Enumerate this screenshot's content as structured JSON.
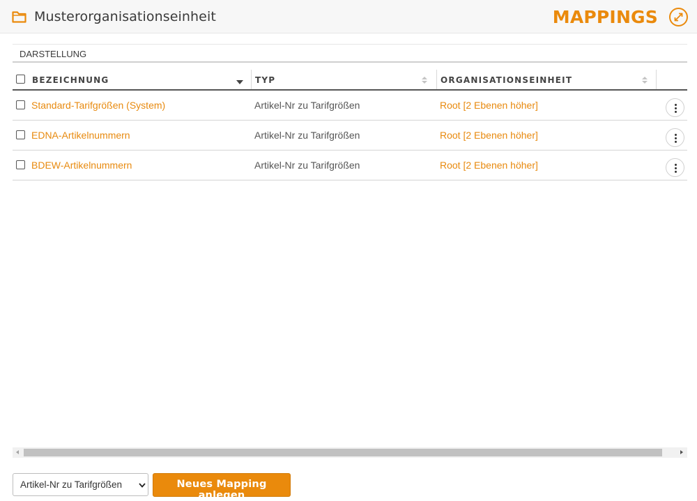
{
  "header": {
    "title": "Musterorganisationseinheit",
    "brand": "MAPPINGS",
    "accent_color": "#ea8a0c"
  },
  "section": {
    "label": "DARSTELLUNG"
  },
  "table": {
    "columns": [
      {
        "label": "BEZEICHNUNG",
        "sort": "descending"
      },
      {
        "label": "TYP",
        "sort": "none"
      },
      {
        "label": "ORGANISATIONSEINHEIT",
        "sort": "none"
      }
    ],
    "rows": [
      {
        "name": "Standard-Tarifgrößen (System)",
        "type": "Artikel-Nr zu Tarifgrößen",
        "org": "Root [2 Ebenen höher]"
      },
      {
        "name": "EDNA-Artikelnummern",
        "type": "Artikel-Nr zu Tarifgrößen",
        "org": "Root [2 Ebenen höher]"
      },
      {
        "name": "BDEW-Artikelnummern",
        "type": "Artikel-Nr zu Tarifgrößen",
        "org": "Root [2 Ebenen höher]"
      }
    ]
  },
  "footer": {
    "select_value": "Artikel-Nr zu Tarifgrößen",
    "new_button_label": "Neues Mapping anlegen"
  },
  "icons": {
    "folder": "folder-icon",
    "expand": "expand-icon",
    "more": "more-vertical-icon",
    "sort": "sort-icon",
    "dropdown": "chevron-down-icon"
  }
}
